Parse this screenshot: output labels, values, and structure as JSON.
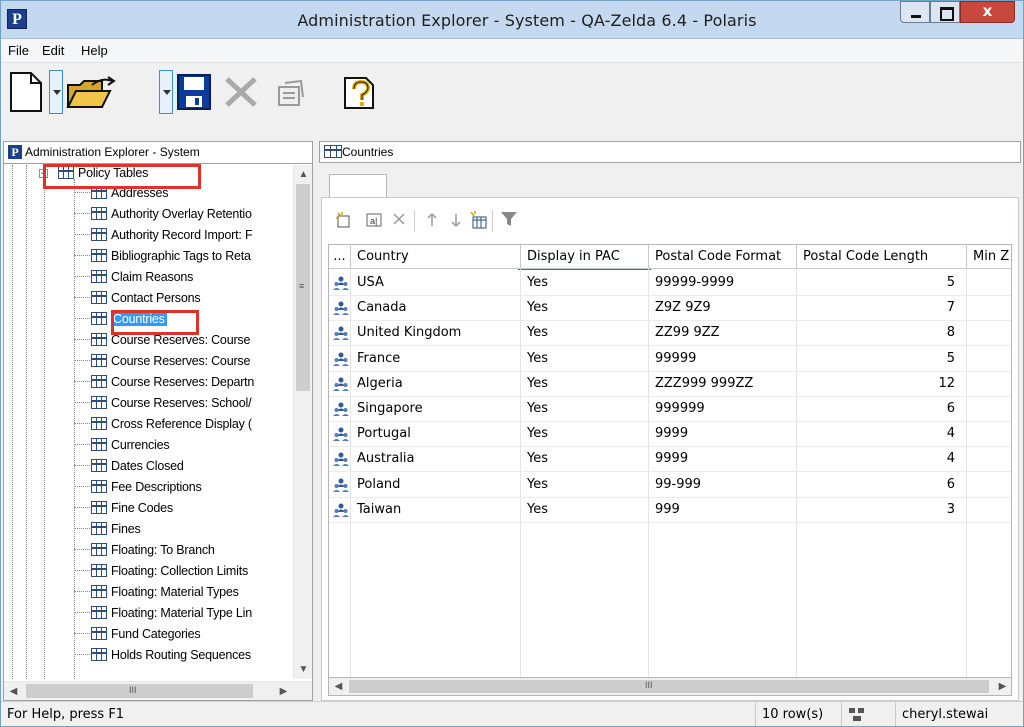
{
  "window": {
    "title": "Administration Explorer - System - QA-Zelda 6.4 - Polaris",
    "app_icon_letter": "P",
    "close_glyph": "x"
  },
  "menu": {
    "file": "File",
    "edit": "Edit",
    "help": "Help"
  },
  "toolbar": {
    "icons": [
      "new-document-icon",
      "open-folder-icon",
      "save-icon",
      "delete-icon",
      "properties-icon",
      "help-icon"
    ]
  },
  "left_pane": {
    "header": "Administration Explorer - System",
    "header_badge": "P",
    "parent_node": "Policy Tables",
    "items": [
      "Addresses",
      "Authority Overlay Retentio",
      "Authority Record Import: F",
      "Bibliographic Tags to Reta",
      "Claim Reasons",
      "Contact Persons",
      "Countries",
      "Course Reserves: Course",
      "Course Reserves: Course",
      "Course Reserves: Departn",
      "Course Reserves: School/",
      "Cross Reference Display (",
      "Currencies",
      "Dates Closed",
      "Fee Descriptions",
      "Fine Codes",
      "Fines",
      "Floating: To Branch",
      "Floating: Collection Limits",
      "Floating: Material Types",
      "Floating: Material Type Lin",
      "Fund Categories",
      "Holds Routing Sequences"
    ],
    "selected_index": 6,
    "hscroll_glyph": "III"
  },
  "right_pane": {
    "header": "Countries",
    "grid_toolbar": [
      "new-row-icon",
      "field-icon",
      "delete-row-icon",
      "move-up-icon",
      "move-down-icon",
      "add-item-icon",
      "filter-icon"
    ],
    "columns": [
      "...",
      "Country",
      "Display in PAC",
      "Postal Code Format",
      "Postal Code Length",
      "Min Z"
    ],
    "rows": [
      {
        "country": "USA",
        "display": "Yes",
        "format": "99999-9999",
        "length": "5"
      },
      {
        "country": "Canada",
        "display": "Yes",
        "format": "Z9Z 9Z9",
        "length": "7"
      },
      {
        "country": "United Kingdom",
        "display": "Yes",
        "format": "ZZ99 9ZZ",
        "length": "8"
      },
      {
        "country": "France",
        "display": "Yes",
        "format": "99999",
        "length": "5"
      },
      {
        "country": "Algeria",
        "display": "Yes",
        "format": "ZZZ999 999ZZ",
        "length": "12"
      },
      {
        "country": "Singapore",
        "display": "Yes",
        "format": "999999",
        "length": "6"
      },
      {
        "country": "Portugal",
        "display": "Yes",
        "format": "9999",
        "length": "4"
      },
      {
        "country": "Australia",
        "display": "Yes",
        "format": "9999",
        "length": "4"
      },
      {
        "country": "Poland",
        "display": "Yes",
        "format": "99-999",
        "length": "6"
      },
      {
        "country": "Taiwan",
        "display": "Yes",
        "format": "999",
        "length": "3"
      }
    ],
    "hscroll_glyph": "III"
  },
  "status": {
    "help": "For Help, press F1",
    "rows": "10 row(s)",
    "user": "cheryl.stewai"
  },
  "colors": {
    "highlight_box": "#e2312d",
    "selection": "#3399ff",
    "titlebar": "#c4d9ef"
  }
}
